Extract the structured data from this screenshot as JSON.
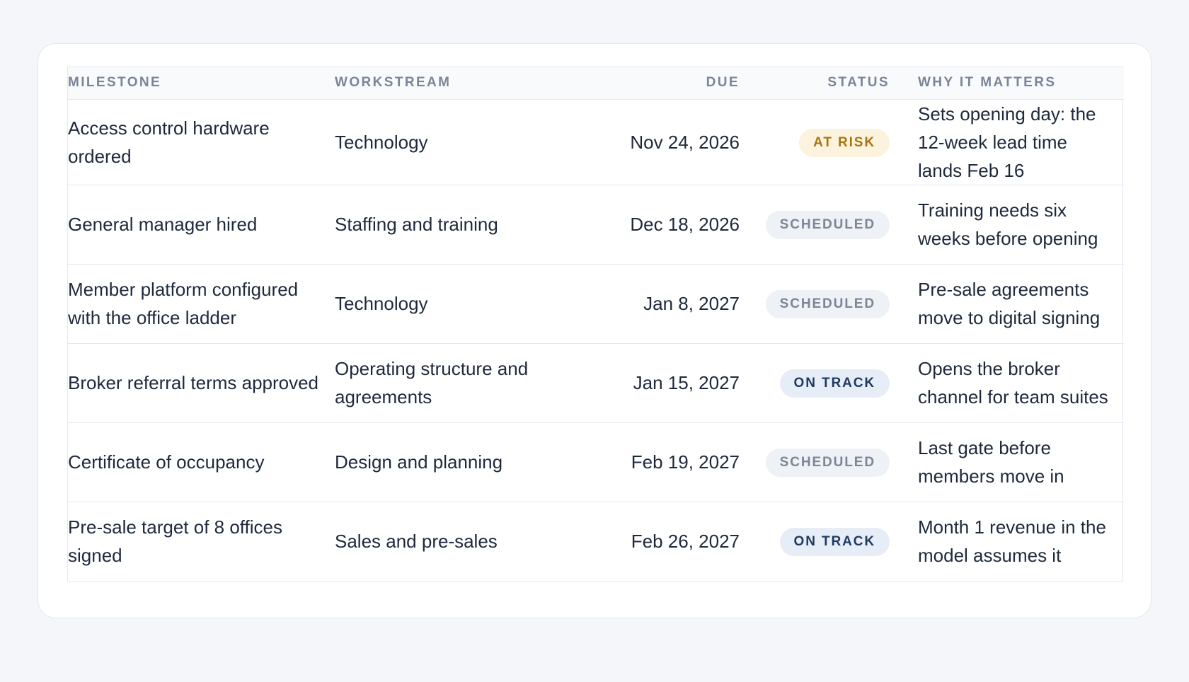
{
  "columns": {
    "milestone": "MILESTONE",
    "workstream": "WORKSTREAM",
    "due": "DUE",
    "status": "STATUS",
    "why": "WHY IT MATTERS"
  },
  "rows": [
    {
      "milestone": "Access control hardware ordered",
      "workstream": "Technology",
      "due": "Nov 24, 2026",
      "status": "AT RISK",
      "status_kind": "at-risk",
      "why": "Sets opening day: the 12-week lead time lands Feb 16"
    },
    {
      "milestone": "General manager hired",
      "workstream": "Staffing and training",
      "due": "Dec 18, 2026",
      "status": "SCHEDULED",
      "status_kind": "scheduled",
      "why": "Training needs six weeks before opening"
    },
    {
      "milestone": "Member platform configured with the office ladder",
      "workstream": "Technology",
      "due": "Jan 8, 2027",
      "status": "SCHEDULED",
      "status_kind": "scheduled",
      "why": "Pre-sale agreements move to digital signing"
    },
    {
      "milestone": "Broker referral terms approved",
      "workstream": "Operating structure and agreements",
      "due": "Jan 15, 2027",
      "status": "ON TRACK",
      "status_kind": "on-track",
      "why": "Opens the broker channel for team suites"
    },
    {
      "milestone": "Certificate of occupancy",
      "workstream": "Design and planning",
      "due": "Feb 19, 2027",
      "status": "SCHEDULED",
      "status_kind": "scheduled",
      "why": "Last gate before members move in"
    },
    {
      "milestone": "Pre-sale target of 8 offices signed",
      "workstream": "Sales and pre-sales",
      "due": "Feb 26, 2027",
      "status": "ON TRACK",
      "status_kind": "on-track",
      "why": "Month 1 revenue in the model assumes it"
    }
  ],
  "status_colors": {
    "at-risk": {
      "bg": "#fcf3df",
      "fg": "#a8750f"
    },
    "scheduled": {
      "bg": "#eef1f5",
      "fg": "#7a8597"
    },
    "on-track": {
      "bg": "#e6edf6",
      "fg": "#1e3a5f"
    }
  }
}
